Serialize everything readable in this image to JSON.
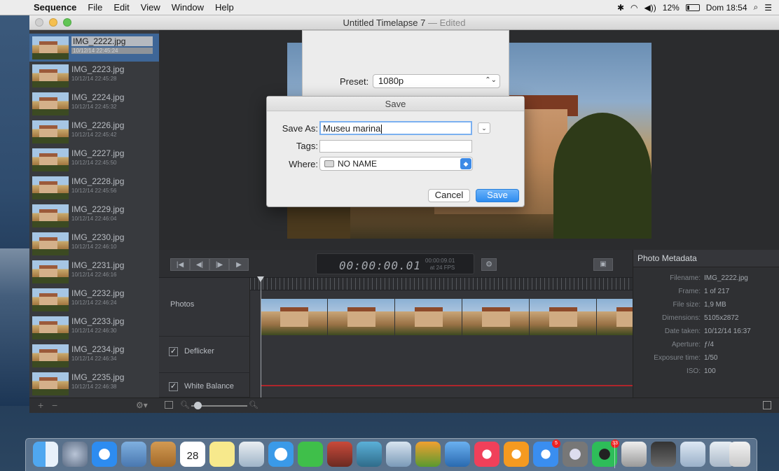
{
  "menubar": {
    "app_name": "Sequence",
    "items": [
      "File",
      "Edit",
      "View",
      "Window",
      "Help"
    ],
    "battery": "12%",
    "datetime": "Dom 18:54",
    "wifi_icon": "wifi-icon"
  },
  "window": {
    "title": "Untitled Timelapse 7",
    "title_suffix": "— Edited"
  },
  "sidebar": {
    "items": [
      {
        "name": "IMG_2222.jpg",
        "date": "10/12/14 22:45:24",
        "selected": true
      },
      {
        "name": "IMG_2223.jpg",
        "date": "10/12/14 22:45:28"
      },
      {
        "name": "IMG_2224.jpg",
        "date": "10/12/14 22:45:32"
      },
      {
        "name": "IMG_2226.jpg",
        "date": "10/12/14 22:45:42"
      },
      {
        "name": "IMG_2227.jpg",
        "date": "10/12/14 22:45:50"
      },
      {
        "name": "IMG_2228.jpg",
        "date": "10/12/14 22:45:56"
      },
      {
        "name": "IMG_2229.jpg",
        "date": "10/12/14 22:46:04"
      },
      {
        "name": "IMG_2230.jpg",
        "date": "10/12/14 22:46:10"
      },
      {
        "name": "IMG_2231.jpg",
        "date": "10/12/14 22:46:16"
      },
      {
        "name": "IMG_2232.jpg",
        "date": "10/12/14 22:46:24"
      },
      {
        "name": "IMG_2233.jpg",
        "date": "10/12/14 22:46:30"
      },
      {
        "name": "IMG_2234.jpg",
        "date": "10/12/14 22:46:34"
      },
      {
        "name": "IMG_2235.jpg",
        "date": "10/12/14 22:46:38"
      }
    ],
    "footer_plus": "+",
    "footer_minus": "−"
  },
  "export_sheet": {
    "preset_label": "Preset:",
    "preset_value": "1080p"
  },
  "save_dialog": {
    "title": "Save",
    "save_as_label": "Save As:",
    "save_as_value": "Museu marina",
    "tags_label": "Tags:",
    "tags_value": "",
    "where_label": "Where:",
    "where_value": "NO NAME",
    "cancel_label": "Cancel",
    "save_label": "Save"
  },
  "timeline": {
    "timecode": "00:00:00.01",
    "total_time": "00:00:09.01",
    "fps": "at 24 FPS",
    "tracks": {
      "photos": "Photos",
      "deflicker": "Deflicker",
      "white_balance": "White Balance"
    },
    "deflicker_checked": true,
    "white_balance_checked": true
  },
  "metadata": {
    "header": "Photo Metadata",
    "rows": [
      {
        "key": "Filename:",
        "value": "IMG_2222.jpg"
      },
      {
        "key": "Frame:",
        "value": "1 of 217"
      },
      {
        "key": "File size:",
        "value": "1,9 MB"
      },
      {
        "key": "Dimensions:",
        "value": "5105x2872"
      },
      {
        "key": "Date taken:",
        "value": "10/12/14 16:37"
      },
      {
        "key": "Aperture:",
        "value": "ƒ/4"
      },
      {
        "key": "Exposure time:",
        "value": "1/50"
      },
      {
        "key": "ISO:",
        "value": "100"
      }
    ]
  },
  "dock": {
    "calendar_day": "28",
    "badges": {
      "appstore": "5",
      "spotify": "33"
    }
  },
  "colors": {
    "accent": "#2d8cf0",
    "selection": "#3e6697",
    "white_balance_line": "#b0262c"
  }
}
